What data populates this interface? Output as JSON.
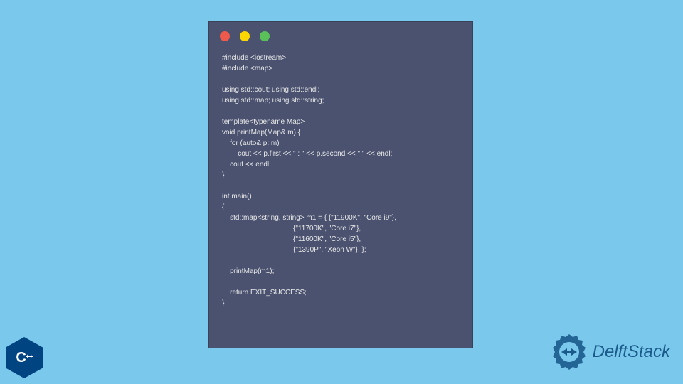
{
  "window": {
    "controls": {
      "close": "close",
      "minimize": "minimize",
      "maximize": "maximize"
    }
  },
  "code": {
    "line1": "#include <iostream>",
    "line2": "#include <map>",
    "line3": "",
    "line4": "using std::cout; using std::endl;",
    "line5": "using std::map; using std::string;",
    "line6": "",
    "line7": "template<typename Map>",
    "line8": "void printMap(Map& m) {",
    "line9": "    for (auto& p: m)",
    "line10": "        cout << p.first << \" : \" << p.second << \";\" << endl;",
    "line11": "    cout << endl;",
    "line12": "}",
    "line13": "",
    "line14": "int main()",
    "line15": "{",
    "line16": "    std::map<string, string> m1 = { {\"11900K\", \"Core i9\"},",
    "line17": "                                    {\"11700K\", \"Core i7\"},",
    "line18": "                                    {\"11600K\", \"Core i5\"},",
    "line19": "                                    {\"1390P\", \"Xeon W\"}, };",
    "line20": "",
    "line21": "    printMap(m1);",
    "line22": "",
    "line23": "    return EXIT_SUCCESS;",
    "line24": "}"
  },
  "badges": {
    "cpp_label": "C",
    "cpp_plus": "++",
    "delftstack_label": "DelftStack"
  }
}
